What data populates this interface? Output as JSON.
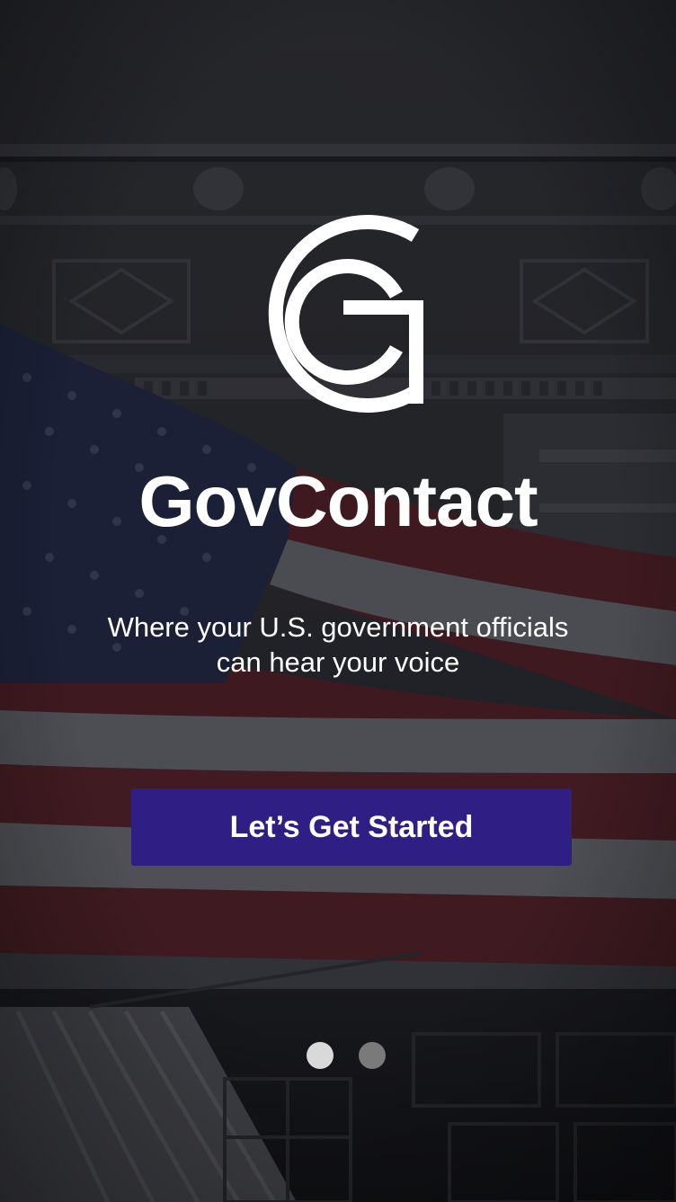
{
  "app": {
    "title": "GovContact",
    "tagline_line1": "Where your U.S. government officials",
    "tagline_line2": "can hear your voice"
  },
  "cta": {
    "label": "Let’s Get Started"
  },
  "pager": {
    "pages": 2,
    "active_page": 1
  },
  "colors": {
    "button": "#2f1f84",
    "text": "#ffffff",
    "dot_active": "#d9d9d9",
    "dot_inactive": "#7a7a7a"
  },
  "icons": {
    "logo": "gc-monogram-icon",
    "background": "us-flag-on-building-image"
  }
}
